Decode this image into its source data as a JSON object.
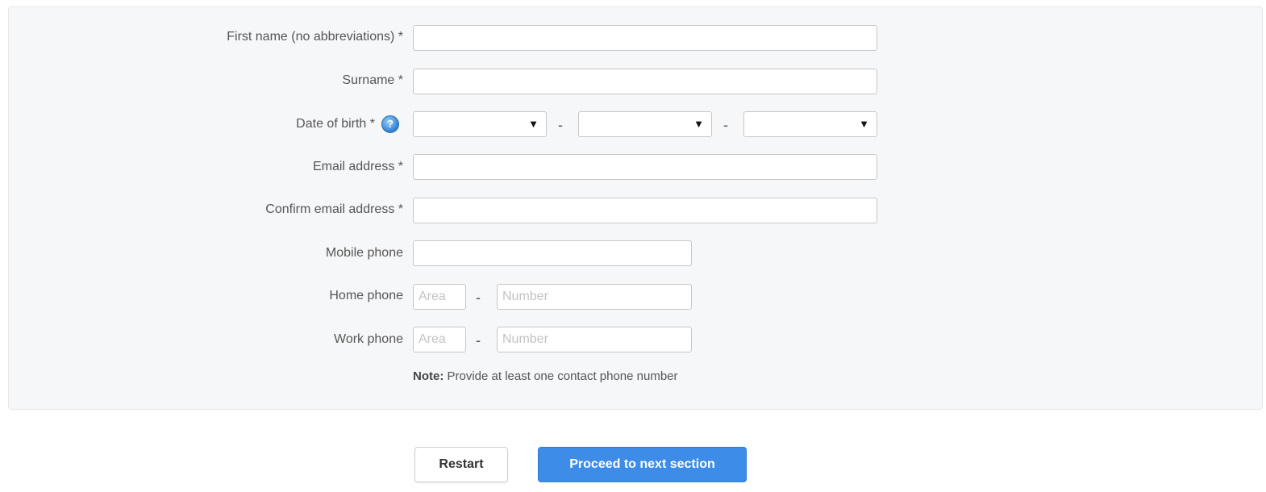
{
  "form": {
    "first_name": {
      "label": "First name (no abbreviations) *",
      "value": ""
    },
    "surname": {
      "label": "Surname *",
      "value": ""
    },
    "date_of_birth": {
      "label": "Date of birth *",
      "day": "",
      "month": "",
      "year": "",
      "separator": "-"
    },
    "email": {
      "label": "Email address *",
      "value": ""
    },
    "confirm_email": {
      "label": "Confirm email address *",
      "value": ""
    },
    "mobile_phone": {
      "label": "Mobile phone",
      "value": ""
    },
    "home_phone": {
      "label": "Home phone",
      "area_placeholder": "Area",
      "number_placeholder": "Number",
      "separator": "-"
    },
    "work_phone": {
      "label": "Work phone",
      "area_placeholder": "Area",
      "number_placeholder": "Number",
      "separator": "-"
    },
    "note": {
      "prefix": "Note:",
      "text": " Provide at least one contact phone number"
    }
  },
  "actions": {
    "restart_label": "Restart",
    "proceed_label": "Proceed to next section"
  },
  "colors": {
    "panel_bg": "#f6f7f8",
    "primary_button": "#3d8ce8",
    "help_icon": "#2f7fcf"
  },
  "icons": {
    "help": "help-icon",
    "dropdown": "triangle-down-icon"
  }
}
